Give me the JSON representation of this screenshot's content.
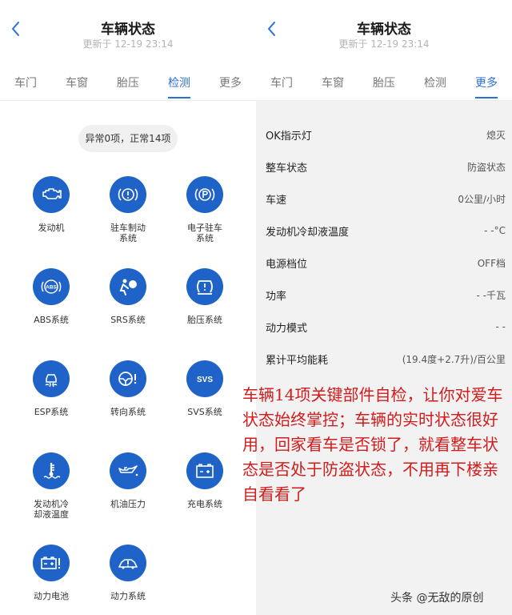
{
  "left": {
    "title": "车辆状态",
    "updated": "更新于 12-19 23:14",
    "tabs": [
      "车门",
      "车窗",
      "胎压",
      "检测",
      "更多"
    ],
    "active_tab": "检测",
    "summary": "异常0项，正常14项",
    "systems": [
      {
        "label": "发动机",
        "icon": "engine-icon"
      },
      {
        "label": "驻车制动\n系统",
        "icon": "parking-brake-icon"
      },
      {
        "label": "电子驻车\n系统",
        "icon": "electronic-parking-icon"
      },
      {
        "label": "ABS系统",
        "icon": "abs-icon"
      },
      {
        "label": "SRS系统",
        "icon": "airbag-icon"
      },
      {
        "label": "胎压系统",
        "icon": "tire-pressure-icon"
      },
      {
        "label": "ESP系统",
        "icon": "esp-icon"
      },
      {
        "label": "转向系统",
        "icon": "steering-warning-icon"
      },
      {
        "label": "SVS系统",
        "icon": "svs-icon"
      },
      {
        "label": "发动机冷\n却液温度",
        "icon": "coolant-temperature-icon"
      },
      {
        "label": "机油压力",
        "icon": "oil-pressure-icon"
      },
      {
        "label": "充电系统",
        "icon": "battery-charging-icon"
      },
      {
        "label": "动力电池",
        "icon": "power-battery-icon"
      },
      {
        "label": "动力系统",
        "icon": "powertrain-icon"
      }
    ]
  },
  "right": {
    "title": "车辆状态",
    "updated": "更新于 12-19 23:14",
    "tabs": [
      "车门",
      "车窗",
      "胎压",
      "检测",
      "更多"
    ],
    "active_tab": "更多",
    "rows": [
      {
        "label": "OK指示灯",
        "value": "熄灭"
      },
      {
        "label": "整车状态",
        "value": "防盗状态"
      },
      {
        "label": "车速",
        "value": "0公里/小时"
      },
      {
        "label": "发动机冷却液温度",
        "value": "- -°C"
      },
      {
        "label": "电源档位",
        "value": "OFF档"
      },
      {
        "label": "功率",
        "value": "- -千瓦"
      },
      {
        "label": "动力模式",
        "value": "- -"
      },
      {
        "label": "累计平均能耗",
        "value": "(19.4度+2.7升)/百公里"
      }
    ]
  },
  "annotation": "车辆14项关键部件自检，让你对爱车状态始终掌控；车辆的实时状态很好用，回家看车是否锁了，就看整车状态是否处于防盗状态，不用再下楼亲自看看了",
  "watermark": "头条 @无敌的原创",
  "colors": {
    "accent": "#2b6fd6",
    "icon_bg": "#1f62c8",
    "annotation": "#d11c1c"
  }
}
